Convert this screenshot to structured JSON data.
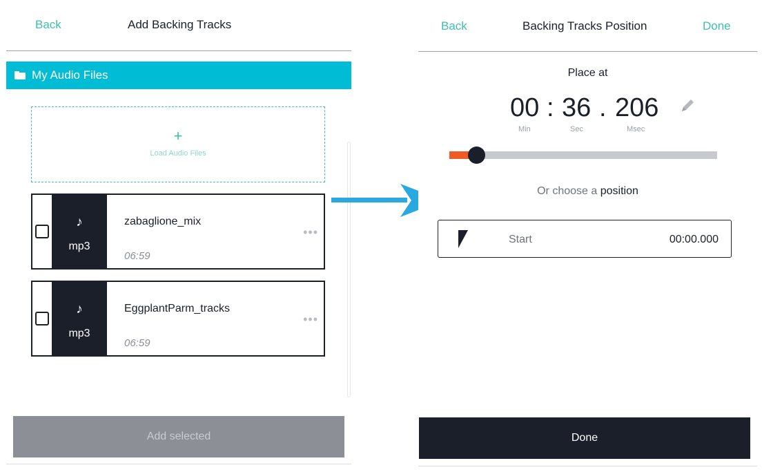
{
  "left_panel": {
    "header": {
      "back_label": "Back",
      "title": "Add Backing Tracks"
    },
    "folder": {
      "label": "My Audio Files"
    },
    "drop_zone": {
      "plus": "+",
      "label": "Load Audio Files"
    },
    "tracks": [
      {
        "icon": "music-note-icon",
        "note": "♪",
        "format": "mp3",
        "name": "zabaglione_mix",
        "duration": "06:59",
        "more": "•••",
        "checked": false
      },
      {
        "icon": "music-note-icon",
        "note": "♪",
        "format": "mp3",
        "name": "EggplantParm_tracks",
        "duration": "06:59",
        "more": "•••",
        "checked": false
      }
    ],
    "add_button": {
      "label": "Add selected",
      "enabled": false
    }
  },
  "right_panel": {
    "header": {
      "back_label": "Back",
      "title": "Backing Tracks Position",
      "done_label": "Done"
    },
    "place_at": "Place at",
    "time": {
      "min": "00",
      "sec": "36",
      "msec": "206",
      "sep1": ":",
      "sep2": ".",
      "min_label": "Min",
      "sec_label": "Sec",
      "msec_label": "Msec"
    },
    "slider": {
      "value": 0.1
    },
    "choose": {
      "prefix": "Or choose a",
      "emphasis": "position"
    },
    "positions": [
      {
        "label": "Start",
        "time": "00:00.000"
      }
    ],
    "done_button": {
      "label": "Done"
    }
  },
  "colors": {
    "accent": "#3dbfad",
    "folder_bar": "#00bcd4",
    "dark": "#1b1f2a",
    "slider_fill": "#f05a28",
    "arrow": "#29a9e0"
  }
}
